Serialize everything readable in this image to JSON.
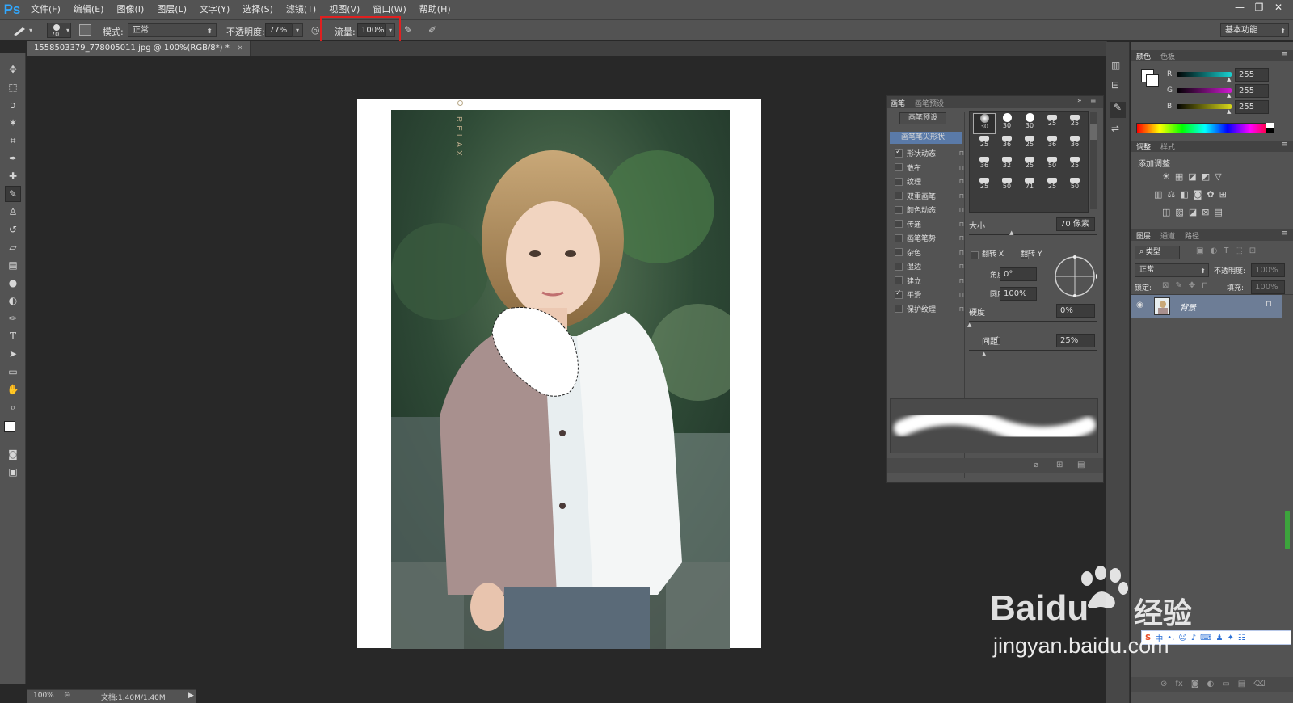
{
  "app": {
    "logo": "Ps"
  },
  "menubar": {
    "items": [
      "文件(F)",
      "编辑(E)",
      "图像(I)",
      "图层(L)",
      "文字(Y)",
      "选择(S)",
      "滤镜(T)",
      "视图(V)",
      "窗口(W)",
      "帮助(H)"
    ]
  },
  "options": {
    "brush_size": "70",
    "mode_label": "模式:",
    "mode_value": "正常",
    "opacity_label": "不透明度:",
    "opacity_value": "77%",
    "flow_label": "流量:",
    "flow_value": "100%",
    "workspace": "基本功能"
  },
  "document": {
    "tab_title": "1558503379_778005011.jpg @ 100%(RGB/8*) *",
    "close": "×",
    "photo_text": "RELAX"
  },
  "status": {
    "zoom": "100%",
    "doc": "文档:1.40M/1.40M"
  },
  "brush_panel": {
    "tabs": [
      "画笔",
      "画笔预设"
    ],
    "preset_button": "画笔预设",
    "tip_shape_label": "画笔笔尖形状",
    "options": [
      {
        "label": "形状动态",
        "checked": true
      },
      {
        "label": "散布",
        "checked": false
      },
      {
        "label": "纹理",
        "checked": false
      },
      {
        "label": "双重画笔",
        "checked": false
      },
      {
        "label": "颜色动态",
        "checked": false
      },
      {
        "label": "传递",
        "checked": false
      },
      {
        "label": "画笔笔势",
        "checked": false
      },
      {
        "label": "杂色",
        "checked": false
      },
      {
        "label": "湿边",
        "checked": false
      },
      {
        "label": "建立",
        "checked": false
      },
      {
        "label": "平滑",
        "checked": true
      },
      {
        "label": "保护纹理",
        "checked": false
      }
    ],
    "tip_sizes": [
      "30",
      "30",
      "30",
      "25",
      "25",
      "25",
      "36",
      "25",
      "36",
      "36",
      "36",
      "32",
      "25",
      "50",
      "25",
      "25",
      "50",
      "71",
      "25",
      "50"
    ],
    "size_label": "大小",
    "size_value": "70 像素",
    "flip_x": "翻转 X",
    "flip_y": "翻转 Y",
    "angle_label": "角度:",
    "angle_value": "0°",
    "roundness_label": "圆度:",
    "roundness_value": "100%",
    "hardness_label": "硬度",
    "hardness_value": "0%",
    "spacing_label": "间距",
    "spacing_value": "25%"
  },
  "color_panel": {
    "tabs": [
      "颜色",
      "色板"
    ],
    "channels": [
      {
        "name": "R",
        "value": "255",
        "color": "#19d2d2"
      },
      {
        "name": "G",
        "value": "255",
        "color": "#d01ad0"
      },
      {
        "name": "B",
        "value": "255",
        "color": "#d8d81a"
      }
    ]
  },
  "adjust_panel": {
    "tabs": [
      "调整",
      "样式"
    ],
    "heading": "添加调整"
  },
  "layers_panel": {
    "tabs": [
      "图层",
      "通道",
      "路径"
    ],
    "filter": "类型",
    "blend": "正常",
    "opacity_label": "不透明度:",
    "opacity_value": "100%",
    "lock_label": "锁定:",
    "fill_label": "填充:",
    "fill_value": "100%",
    "layer_name": "背景"
  },
  "watermark": {
    "brand": "Baidu",
    "brand_cn": "经验",
    "url": "jingyan.baidu.com"
  }
}
